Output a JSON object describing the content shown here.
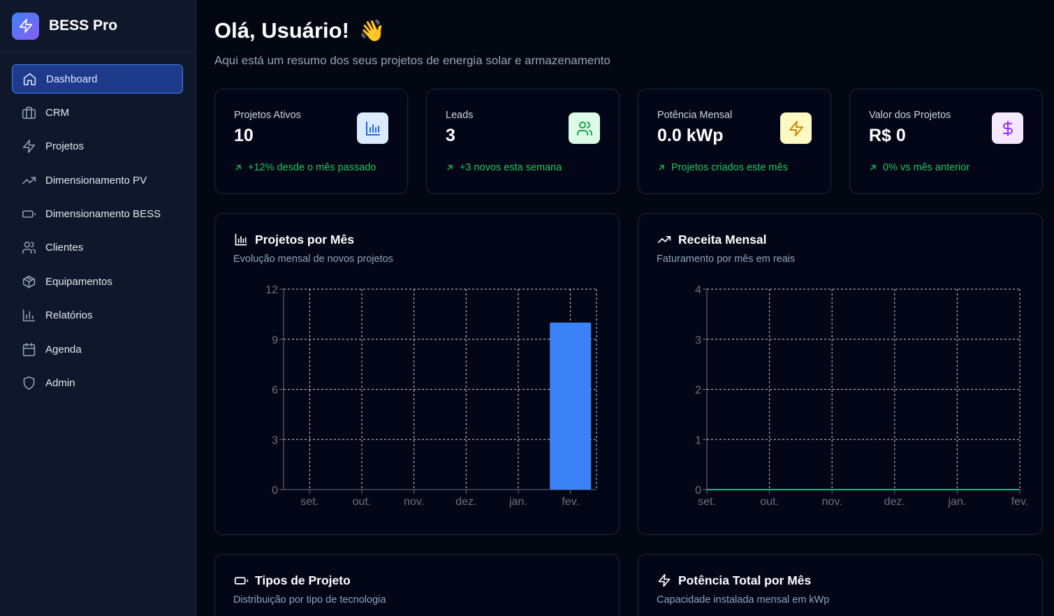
{
  "app": {
    "name": "BESS Pro",
    "logo_icon": "zap-icon"
  },
  "sidebar": {
    "items": [
      {
        "label": "Dashboard",
        "icon": "home-icon",
        "active": true
      },
      {
        "label": "CRM",
        "icon": "briefcase-icon"
      },
      {
        "label": "Projetos",
        "icon": "zap-icon"
      },
      {
        "label": "Dimensionamento PV",
        "icon": "trending-up-icon"
      },
      {
        "label": "Dimensionamento BESS",
        "icon": "battery-icon"
      },
      {
        "label": "Clientes",
        "icon": "users-icon"
      },
      {
        "label": "Equipamentos",
        "icon": "package-icon"
      },
      {
        "label": "Relatórios",
        "icon": "bar-chart-icon"
      },
      {
        "label": "Agenda",
        "icon": "calendar-icon"
      },
      {
        "label": "Admin",
        "icon": "shield-icon"
      }
    ]
  },
  "header": {
    "greeting": "Olá, Usuário!",
    "emoji": "👋",
    "subtitle": "Aqui está um resumo dos seus projetos de energia solar e armazenamento"
  },
  "stats": [
    {
      "label": "Projetos Ativos",
      "value": "10",
      "trend": "+12% desde o mês passado",
      "icon": "bar-chart-icon",
      "icon_bg": "#dbeafe",
      "icon_color": "#2563eb"
    },
    {
      "label": "Leads",
      "value": "3",
      "trend": "+3 novos esta semana",
      "icon": "users-icon",
      "icon_bg": "#dcfce7",
      "icon_color": "#16a34a"
    },
    {
      "label": "Potência Mensal",
      "value": "0.0 kWp",
      "trend": "Projetos criados este mês",
      "icon": "zap-icon",
      "icon_bg": "#fef9c3",
      "icon_color": "#ca8a04"
    },
    {
      "label": "Valor dos Projetos",
      "value": "R$ 0",
      "trend": "0% vs mês anterior",
      "icon": "dollar-icon",
      "icon_bg": "#f3e8ff",
      "icon_color": "#9333ea"
    }
  ],
  "charts": {
    "projetos": {
      "title": "Projetos por Mês",
      "subtitle": "Evolução mensal de novos projetos"
    },
    "receita": {
      "title": "Receita Mensal",
      "subtitle": "Faturamento por mês em reais"
    },
    "tipos": {
      "title": "Tipos de Projeto",
      "subtitle": "Distribuição por tipo de tecnologia"
    },
    "potencia": {
      "title": "Potência Total por Mês",
      "subtitle": "Capacidade instalada mensal em kWp"
    }
  },
  "chart_data": [
    {
      "type": "bar",
      "title": "Projetos por Mês",
      "categories": [
        "set.",
        "out.",
        "nov.",
        "dez.",
        "jan.",
        "fev."
      ],
      "values": [
        0,
        0,
        0,
        0,
        0,
        10
      ],
      "ylim": [
        0,
        12
      ],
      "yticks": [
        0,
        3,
        6,
        9,
        12
      ],
      "grid": true,
      "color": "#3b82f6"
    },
    {
      "type": "line",
      "title": "Receita Mensal",
      "categories": [
        "set.",
        "out.",
        "nov.",
        "dez.",
        "jan.",
        "fev."
      ],
      "values": [
        0,
        0,
        0,
        0,
        0,
        0
      ],
      "ylim": [
        0,
        4
      ],
      "yticks": [
        0,
        1,
        2,
        3,
        4
      ],
      "grid": true,
      "color": "#10b981"
    }
  ]
}
